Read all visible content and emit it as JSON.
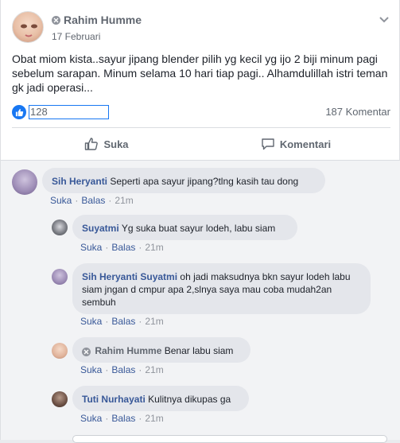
{
  "post": {
    "author": "Rahim Humme",
    "date": "17 Februari",
    "text": "Obat miom kista..sayur jipang blender pilih yg kecil yg ijo 2 biji minum pagi sebelum sarapan. Minum selama 10 hari tiap pagi.. Alhamdulillah istri teman gk jadi operasi...",
    "like_count": "128",
    "comment_count": "187 Komentar"
  },
  "actions": {
    "like": "Suka",
    "comment": "Komentari"
  },
  "comments": [
    {
      "name": "Sih Heryanti",
      "text": "Seperti apa sayur jipang?tlng kasih tau dong",
      "like": "Suka",
      "reply": "Balas",
      "time": "21m"
    },
    {
      "name": "Suyatmi",
      "text": "Yg suka buat sayur lodeh, labu siam",
      "like": "Suka",
      "reply": "Balas",
      "time": "21m"
    },
    {
      "name": "Sih Heryanti",
      "tag": "Suyatmi",
      "text": " oh jadi maksudnya bkn sayur lodeh labu siam jngan d cmpur apa 2,slnya saya mau coba mudah2an sembuh",
      "like": "Suka",
      "reply": "Balas",
      "time": "21m"
    },
    {
      "name": "Rahim Humme",
      "text": "Benar labu siam",
      "like": "Suka",
      "reply": "Balas",
      "time": "21m"
    },
    {
      "name": "Tuti Nurhayati",
      "text": "Kulitnya dikupas ga",
      "like": "Suka",
      "reply": "Balas",
      "time": "21m"
    }
  ],
  "colors": {
    "link": "#385898",
    "like_blue": "#1877f2",
    "bubble": "#e4e6eb",
    "meta_gray": "#90949c"
  }
}
